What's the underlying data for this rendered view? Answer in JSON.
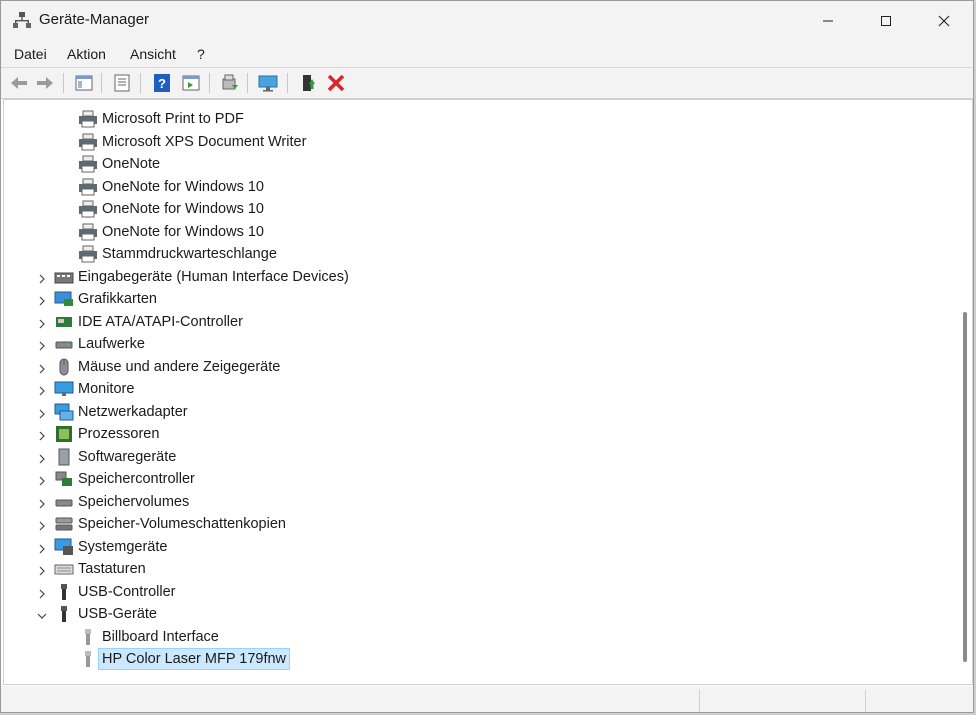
{
  "window": {
    "title": "Geräte-Manager"
  },
  "menu": [
    "Datei",
    "Aktion",
    "Ansicht",
    "?"
  ],
  "toolbar": {
    "buttons": [
      "back-icon",
      "forward-icon",
      "show-hide-console-tree-icon",
      "properties-icon",
      "help-icon",
      "action-pane-icon",
      "update-driver-icon",
      "scan-hardware-icon",
      "enable-device-icon",
      "uninstall-icon"
    ]
  },
  "tree": {
    "printers": [
      "Microsoft Print to PDF",
      "Microsoft XPS Document Writer",
      "OneNote",
      "OneNote for Windows 10",
      "OneNote for Windows 10",
      "OneNote for Windows 10",
      "Stammdruckwarteschlange"
    ],
    "categories": [
      "Eingabegeräte (Human Interface Devices)",
      "Grafikkarten",
      "IDE ATA/ATAPI-Controller",
      "Laufwerke",
      "Mäuse und andere Zeigegeräte",
      "Monitore",
      "Netzwerkadapter",
      "Prozessoren",
      "Softwaregeräte",
      "Speichercontroller",
      "Speichervolumes",
      "Speicher-Volumeschattenkopien",
      "Systemgeräte",
      "Tastaturen",
      "USB-Controller",
      "USB-Geräte"
    ],
    "usb_devices": [
      "Billboard Interface",
      "HP Color Laser MFP 179fnw"
    ],
    "selected": "HP Color Laser MFP 179fnw"
  },
  "colors": {
    "selection_bg": "#cce8ff",
    "selection_border": "#99d1ff",
    "delete_red": "#d9262c"
  }
}
